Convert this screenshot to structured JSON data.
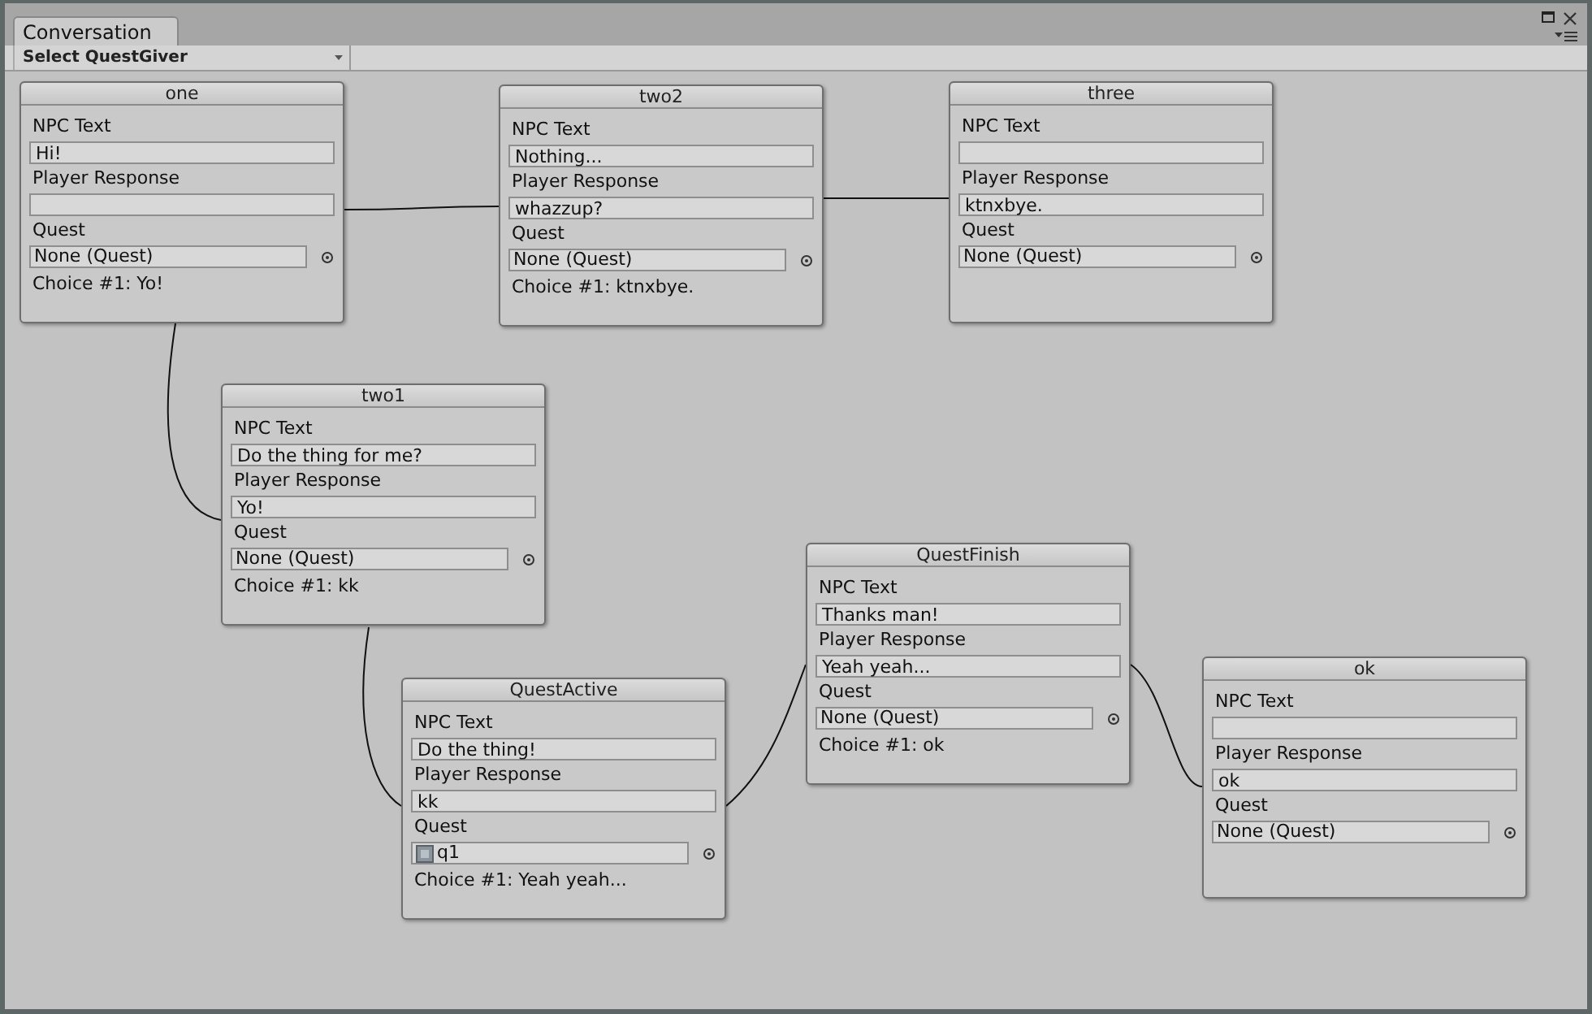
{
  "window": {
    "tab": "Conversation"
  },
  "toolbar": {
    "dropdown": "Select QuestGiver"
  },
  "nodes": [
    {
      "title": "one",
      "npc_label": "NPC Text",
      "npc_text": "Hi!",
      "response_label": "Player Response",
      "quest_label": "Quest",
      "quest": "None (Quest)",
      "quest_has_icon": false,
      "choice": "Choice #1: Yo!"
    },
    {
      "title": "two2",
      "npc_label": "NPC Text",
      "npc_text": "Nothing...",
      "response_label": "Player Response",
      "response": "whazzup?",
      "quest_label": "Quest",
      "quest": "None (Quest)",
      "quest_has_icon": false,
      "choice": "Choice #1: ktnxbye."
    },
    {
      "title": "three",
      "npc_label": "NPC Text",
      "response_label": "Player Response",
      "response": "ktnxbye.",
      "quest_label": "Quest",
      "quest": "None (Quest)",
      "quest_has_icon": false
    },
    {
      "title": "two1",
      "npc_label": "NPC Text",
      "npc_text": "Do the thing for me?",
      "response_label": "Player Response",
      "response": "Yo!",
      "quest_label": "Quest",
      "quest": "None (Quest)",
      "quest_has_icon": false,
      "choice": "Choice #1: kk"
    },
    {
      "title": "QuestActive",
      "npc_label": "NPC Text",
      "npc_text": "Do the thing!",
      "response_label": "Player Response",
      "response": "kk",
      "quest_label": "Quest",
      "quest": "q1",
      "quest_has_icon": true,
      "choice": "Choice #1: Yeah yeah..."
    },
    {
      "title": "QuestFinish",
      "npc_label": "NPC Text",
      "npc_text": "Thanks man!",
      "response_label": "Player Response",
      "response": "Yeah yeah...",
      "quest_label": "Quest",
      "quest": "None (Quest)",
      "quest_has_icon": false,
      "choice": "Choice #1: ok"
    },
    {
      "title": "ok",
      "npc_label": "NPC Text",
      "response_label": "Player Response",
      "response": "ok",
      "quest_label": "Quest",
      "quest": "None (Quest)",
      "quest_has_icon": false
    }
  ]
}
